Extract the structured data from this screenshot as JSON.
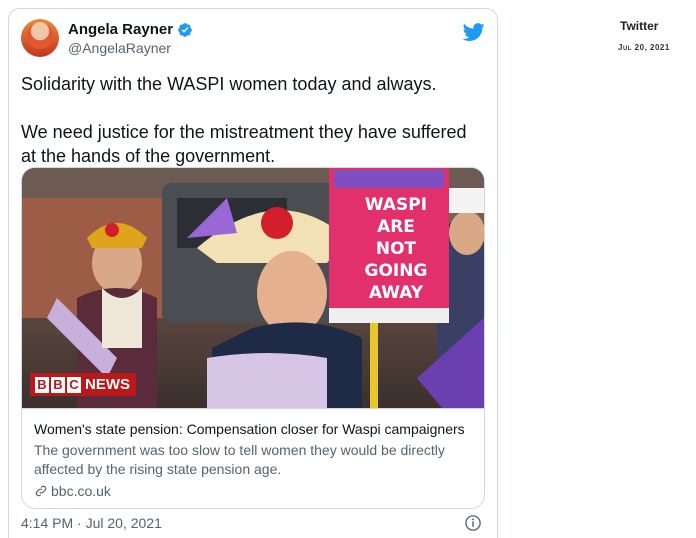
{
  "tweet": {
    "display_name": "Angela Rayner",
    "handle": "@AngelaRayner",
    "paragraphs": [
      "Solidarity with the WASPI women today and always.",
      "We need justice for the mistreatment they have suffered at the hands of the government."
    ],
    "timestamp": "4:14 PM · Jul 20, 2021"
  },
  "card": {
    "title": "Women's state pension: Compensation closer for Waspi campaigners",
    "description": "The government was too slow to tell women they would be directly affected by the rising state pension age.",
    "domain": "bbc.co.uk",
    "image": {
      "badge_word": "NEWS",
      "badge_letters": [
        "B",
        "B",
        "C"
      ],
      "placard_lines": [
        "WASPI",
        "ARE",
        "NOT",
        "GOING",
        "AWAY"
      ]
    }
  },
  "side": {
    "source": "Twitter",
    "date": "Jul 20, 2021"
  },
  "colors": {
    "twitter_blue": "#1d9bf0",
    "bbc_red": "#bb1919",
    "placard_pink": "#e2306c"
  }
}
